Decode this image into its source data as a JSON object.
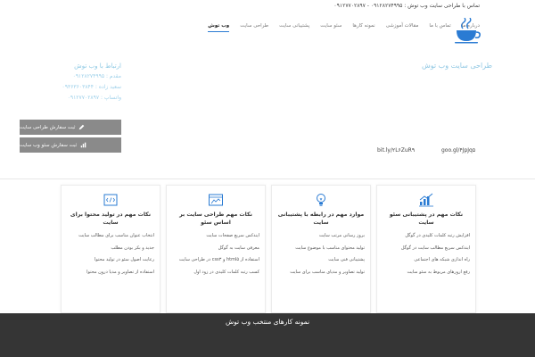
{
  "topbar": {
    "contact_text": "تماس با طراحی سایت وب توش : ۰۹۱۲۸۲۷۴۹۹۵ - ۰۹۱۲۷۷۰۲۸۹۷"
  },
  "nav": {
    "items": [
      "وب توش",
      "طراحی سایت",
      "پشتیبانی سایت",
      "سئو سایت",
      "نمونه کارها",
      "مقالات آموزشی",
      "تماس با ما",
      "درباره ما"
    ],
    "active_index": 0
  },
  "hero": {
    "title": "طراحی سایت وب توش"
  },
  "contact_block": {
    "heading": "ارتباط با وب توش",
    "lines": [
      "مقدم : ۰۹۱۲۸۲۷۴۹۹۵",
      "سعید زاده : ۰۹۳۶۳۶۰۳۸۴۴",
      "واتساپ : ۰۹۱۲۷۷۰۲۸۹۷"
    ]
  },
  "buttons": {
    "order_design": "ثبت سفارش طراحی سایت",
    "order_seo": "ثبت سفارش سئو وب سایت"
  },
  "short_links": {
    "left": "bit.ly/۲L۶ZuR۹",
    "right": "goo.gl/۴JpJq۵"
  },
  "cards": [
    {
      "icon": "chart-up-icon",
      "title": "نکات مهم در پشتیبانی سئو سایت",
      "items": [
        "افزایش رتبه کلمات کلیدی در گوگل",
        "ایندکس سریع مطالب سایت در گوگل",
        "راه اندازی شبکه های اجتماعی",
        "رفع ارورهای مربوط به سئو سایت"
      ]
    },
    {
      "icon": "lightbulb-icon",
      "title": "موارد مهم در رابطه با پشتیبانی سایت",
      "items": [
        "بروز رسانی مرتب سایت",
        "تولید محتوای مناسب با موضوع سایت",
        "پشتیبانی فنی سایت",
        "تولید تصاویر و مدیای مناسب برای سایت"
      ]
    },
    {
      "icon": "web-window-icon",
      "title": "نکات مهم طراحی سایت بر اساس سئو",
      "items": [
        "ایندکس سریع صفحات سایت",
        "معرفی سایت به گوگل",
        "استفاده از html۵ و css۳ در طراحی سایت",
        "کسب رتبه کلمات کلیدی در زود اول"
      ]
    },
    {
      "icon": "code-icon",
      "title": "نکات مهم در تولید محتوا برای سایت",
      "items": [
        "انتخاب عنوان مناسب برای مطالب سایت",
        "جدید و بکر بودن مطلب",
        "رعایت اصول سئو در تولید محتوا",
        "استفاده از تصاویر و مدیا درون محتوا"
      ]
    }
  ],
  "footer": {
    "title": "نمونه کارهای منتخب وب توش"
  },
  "colors": {
    "accent": "#2a7bd3",
    "hero_text": "#8fc7e3",
    "button_bg": "#8a8a8a",
    "footer_bg": "#353535"
  }
}
